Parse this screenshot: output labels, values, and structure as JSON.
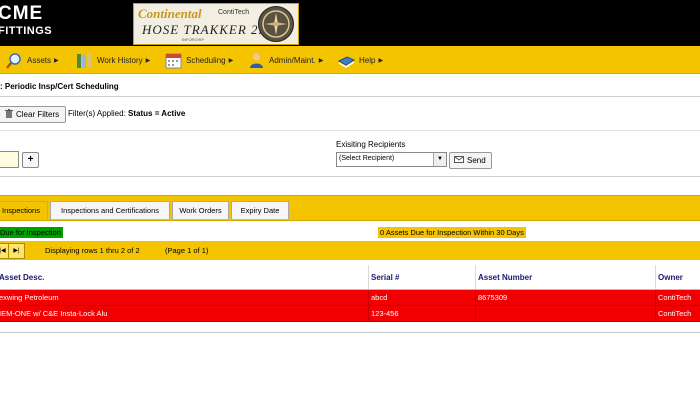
{
  "header": {
    "logo_line1": "CME",
    "logo_line2": "FITTINGS",
    "brand_name": "Continental",
    "brand_sub": "ContiTech",
    "product": "HOSE TRAKKER 2.0",
    "powered": "INFORCHIP"
  },
  "nav": [
    {
      "label": "Assets",
      "icon": "magnifier-icon"
    },
    {
      "label": "Work History",
      "icon": "books-icon"
    },
    {
      "label": "Scheduling",
      "icon": "calendar-icon"
    },
    {
      "label": "Admin/Maint.",
      "icon": "user-icon"
    },
    {
      "label": "Help",
      "icon": "book-icon"
    }
  ],
  "page": {
    "title": ": Periodic Insp/Cert Scheduling",
    "clear_filters": "Clear Filters",
    "filters_applied": "Filter(s) Applied:",
    "filter_value": "Status = Active"
  },
  "recipients": {
    "label": "Exisiting Recipients",
    "selected": "(Select Recipient)",
    "send": "Send"
  },
  "tabs": [
    {
      "label": "Inspections",
      "active": true
    },
    {
      "label": "Inspections and Certifications",
      "active": false
    },
    {
      "label": "Work Orders",
      "active": false
    },
    {
      "label": "Expiry Date",
      "active": false
    }
  ],
  "due": {
    "left": "Due for Inspection",
    "right": "0 Assets Due for Inspection Within 30 Days"
  },
  "pager": {
    "display": "Displaying rows 1 thru 2 of 2",
    "page": "(Page 1 of 1)"
  },
  "table": {
    "headers": [
      "Asset Desc.",
      "Serial #",
      "Asset Number",
      "Owner"
    ],
    "rows": [
      [
        "exwing Petroleum",
        "abcd",
        "8675309",
        "ContiTech"
      ],
      [
        "IEM-ONE w/ C&E Insta-Lock Alu",
        "123-456",
        "",
        "ContiTech"
      ]
    ]
  },
  "colors": {
    "accent": "#f5c400",
    "row_alert": "#f00000",
    "due_ok": "#00a000"
  }
}
